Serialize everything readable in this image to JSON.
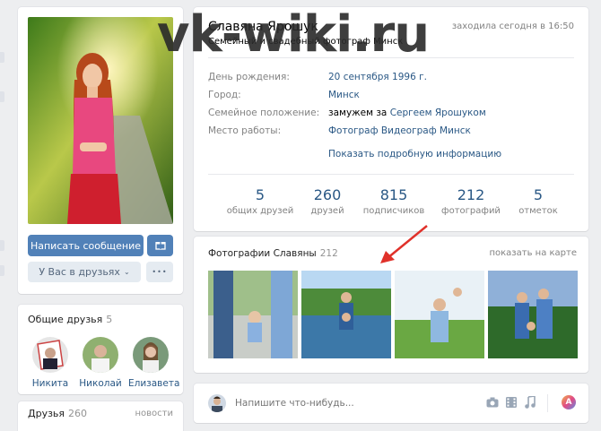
{
  "watermark": "vk-wiki.ru",
  "profile": {
    "name": "Славяна Ярошук",
    "status": "Семейный и свадебный фотограф Минск",
    "online": "заходила сегодня в 16:50",
    "fields": [
      {
        "label": "День рождения:",
        "value": "20 сентября 1996 г."
      },
      {
        "label": "Город:",
        "value": "Минск"
      },
      {
        "label": "Семейное положение:",
        "value_plain": "замужем за",
        "value": "Сергеем Ярошуком"
      },
      {
        "label": "Место работы:",
        "value": "Фотограф Видеограф Минск"
      }
    ],
    "more_info": "Показать подробную информацию",
    "counters": [
      {
        "num": "5",
        "label": "общих друзей"
      },
      {
        "num": "260",
        "label": "друзей"
      },
      {
        "num": "815",
        "label": "подписчиков"
      },
      {
        "num": "212",
        "label": "фотографий"
      },
      {
        "num": "5",
        "label": "отметок"
      }
    ]
  },
  "actions": {
    "message": "Написать сообщение",
    "friends": "У Вас в друзьях",
    "more": "•••"
  },
  "mutual": {
    "title": "Общие друзья",
    "count": "5",
    "people": [
      "Никита",
      "Николай",
      "Елизавета"
    ]
  },
  "friends": {
    "title": "Друзья",
    "count": "260",
    "news": "новости"
  },
  "photos": {
    "title": "Фотографии Славяны",
    "count": "212",
    "map_link": "показать на карте"
  },
  "post": {
    "placeholder": "Напишите что-нибудь..."
  },
  "icons": [
    "camera-icon",
    "video-icon",
    "music-icon",
    "gift-icon",
    "chevron-down-icon",
    "arrow-icon"
  ],
  "colors": {
    "accent": "#5181b8",
    "link": "#2a5885",
    "background": "#edeef0",
    "arrow": "#e0312a"
  }
}
